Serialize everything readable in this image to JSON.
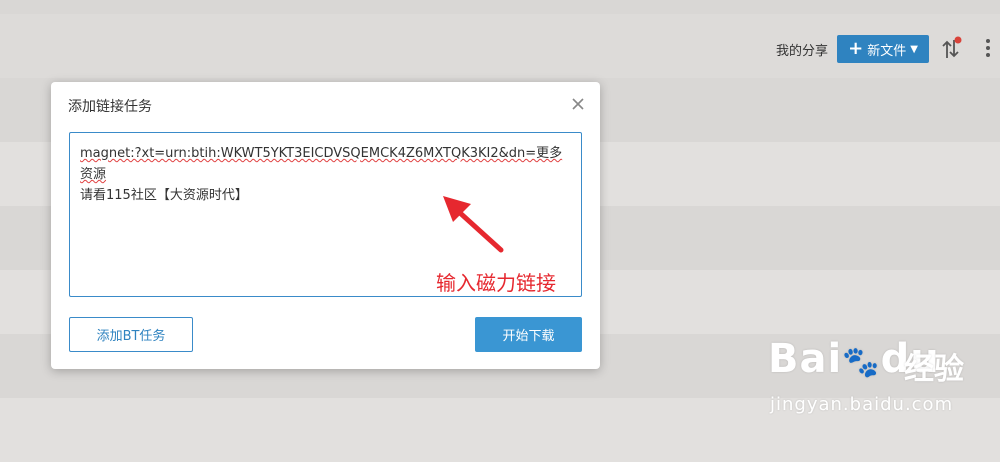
{
  "header": {
    "my_share_label": "我的分享",
    "new_file_label": "新文件",
    "accent_color": "#2f83c0"
  },
  "dialog": {
    "title": "添加链接任务",
    "input_value": "magnet:?xt=urn:btih:WKWT5YKT3EICDVSQEMCK4Z6MXTQK3KI2&dn=更多资源请看115社区【大资源时代】",
    "input_value_line1": "magnet:?xt=urn:btih:WKWT5YKT3EICDVSQEMCK4Z6MXTQK3KI2&dn=更多资源",
    "input_value_line2": "请看115社区【大资源时代】",
    "annotation_text": "输入磁力链接",
    "add_bt_label": "添加BT任务",
    "start_download_label": "开始下载"
  },
  "watermark": {
    "brand": "Bai",
    "brand2": "du",
    "jingyan": "经验",
    "url": "jingyan.baidu.com"
  }
}
